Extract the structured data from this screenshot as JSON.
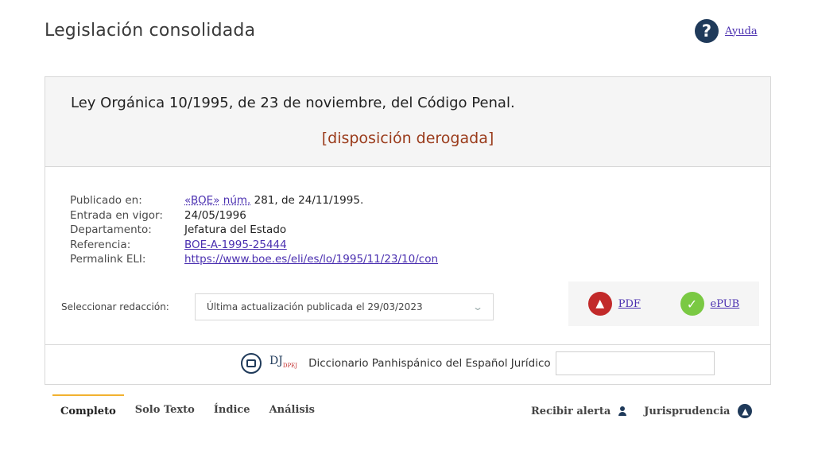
{
  "header": {
    "title": "Legislación consolidada",
    "help_label": "Ayuda"
  },
  "law": {
    "title": "Ley Orgánica 10/1995, de 23 de noviembre, del Código Penal.",
    "status": "[disposición derogada]"
  },
  "meta": {
    "publicado_label": "Publicado en:",
    "publicado_boe": "«BOE»",
    "publicado_num_abbr": "núm.",
    "publicado_rest": " 281, de 24/11/1995.",
    "vigor_label": "Entrada en vigor:",
    "vigor_value": "24/05/1996",
    "departamento_label": "Departamento:",
    "departamento_value": "Jefatura del Estado",
    "referencia_label": "Referencia:",
    "referencia_value": "BOE-A-1995-25444",
    "permalink_label": "Permalink ELI:",
    "permalink_value": "https://www.boe.es/eli/es/lo/1995/11/23/10/con"
  },
  "redaccion": {
    "label": "Seleccionar redacción:",
    "selected": "Última actualización publicada el 29/03/2023"
  },
  "downloads": {
    "pdf_label": "PDF",
    "epub_label": "ePUB"
  },
  "dictionary": {
    "logo_text": "DJ",
    "logo_sub": "DPEJ",
    "label": "Diccionario Panhispánico del Español Jurídico",
    "input_value": ""
  },
  "tabs": [
    {
      "label": "Completo"
    },
    {
      "label": "Solo Texto"
    },
    {
      "label": "Índice"
    },
    {
      "label": "Análisis"
    }
  ],
  "actions": {
    "alerta_label": "Recibir alerta",
    "jurisprudencia_label": "Jurisprudencia"
  },
  "colors": {
    "brand": "#1f3a5a",
    "link": "#4a2fb0",
    "derogada": "#9a3b1b",
    "tab_accent": "#f2b230",
    "pdf": "#c22a2a",
    "epub": "#7ac943"
  },
  "icons": [
    "help-icon",
    "pdf-icon",
    "epub-icon",
    "dictionary-icon",
    "chevron-down-icon",
    "user-icon",
    "jurisprudencia-icon"
  ]
}
